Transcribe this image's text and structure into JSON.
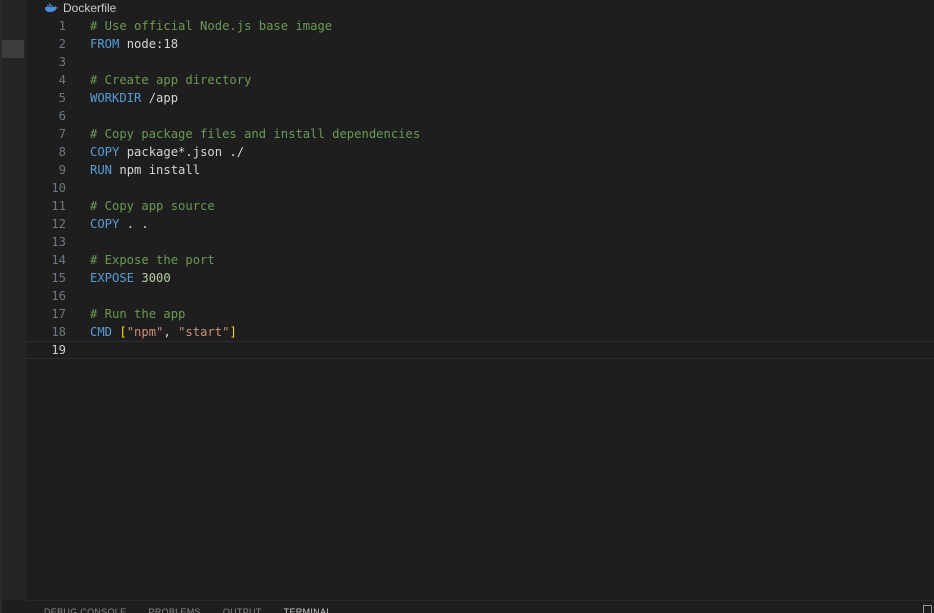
{
  "tab": {
    "filename": "Dockerfile",
    "icon": "docker-whale-icon"
  },
  "editor": {
    "current_line": 19,
    "lines": [
      {
        "n": "1",
        "tokens": [
          {
            "t": "# Use official Node.js base image",
            "c": "comment"
          }
        ]
      },
      {
        "n": "2",
        "tokens": [
          {
            "t": "FROM",
            "c": "keyword"
          },
          {
            "t": " node:18",
            "c": "text"
          }
        ]
      },
      {
        "n": "3",
        "tokens": []
      },
      {
        "n": "4",
        "tokens": [
          {
            "t": "# Create app directory",
            "c": "comment"
          }
        ]
      },
      {
        "n": "5",
        "tokens": [
          {
            "t": "WORKDIR",
            "c": "keyword"
          },
          {
            "t": " /app",
            "c": "text"
          }
        ]
      },
      {
        "n": "6",
        "tokens": []
      },
      {
        "n": "7",
        "tokens": [
          {
            "t": "# Copy package files and install dependencies",
            "c": "comment"
          }
        ]
      },
      {
        "n": "8",
        "tokens": [
          {
            "t": "COPY",
            "c": "keyword"
          },
          {
            "t": " package*.json ./",
            "c": "text"
          }
        ]
      },
      {
        "n": "9",
        "tokens": [
          {
            "t": "RUN",
            "c": "keyword"
          },
          {
            "t": " npm install",
            "c": "text"
          }
        ]
      },
      {
        "n": "10",
        "tokens": []
      },
      {
        "n": "11",
        "tokens": [
          {
            "t": "# Copy app source",
            "c": "comment"
          }
        ]
      },
      {
        "n": "12",
        "tokens": [
          {
            "t": "COPY",
            "c": "keyword"
          },
          {
            "t": " . .",
            "c": "text"
          }
        ]
      },
      {
        "n": "13",
        "tokens": []
      },
      {
        "n": "14",
        "tokens": [
          {
            "t": "# Expose the port",
            "c": "comment"
          }
        ]
      },
      {
        "n": "15",
        "tokens": [
          {
            "t": "EXPOSE",
            "c": "keyword"
          },
          {
            "t": " ",
            "c": "text"
          },
          {
            "t": "3000",
            "c": "number"
          }
        ]
      },
      {
        "n": "16",
        "tokens": []
      },
      {
        "n": "17",
        "tokens": [
          {
            "t": "# Run the app",
            "c": "comment"
          }
        ]
      },
      {
        "n": "18",
        "tokens": [
          {
            "t": "CMD",
            "c": "keyword"
          },
          {
            "t": " ",
            "c": "text"
          },
          {
            "t": "[",
            "c": "bracket"
          },
          {
            "t": "\"npm\"",
            "c": "string"
          },
          {
            "t": ", ",
            "c": "text"
          },
          {
            "t": "\"start\"",
            "c": "string"
          },
          {
            "t": "]",
            "c": "bracket"
          }
        ]
      },
      {
        "n": "19",
        "tokens": []
      }
    ]
  },
  "panel": {
    "tabs": [
      "DEBUG CONSOLE",
      "PROBLEMS",
      "OUTPUT",
      "TERMINAL"
    ],
    "active_tab": "TERMINAL",
    "corner_icon": "maximize-panel-icon"
  },
  "colors": {
    "background": "#1e1e1e",
    "comment": "#6a9955",
    "keyword": "#569cd6",
    "string": "#ce9178",
    "number": "#b5cea8",
    "bracket": "#ffd700"
  }
}
